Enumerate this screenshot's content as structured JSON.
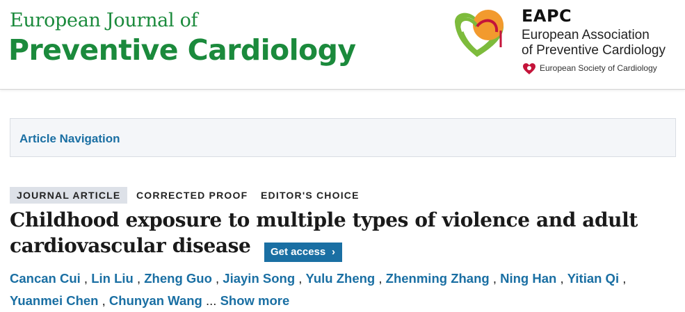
{
  "header": {
    "journal_line1": "European Journal of",
    "journal_line2": "Preventive Cardiology",
    "eapc_abbrev": "EAPC",
    "eapc_line1": "European Association",
    "eapc_line2": "of Preventive Cardiology",
    "esc_name": "European Society of Cardiology"
  },
  "nav": {
    "article_navigation": "Article Navigation"
  },
  "article": {
    "tags": [
      "JOURNAL ARTICLE",
      "CORRECTED PROOF",
      "EDITOR'S CHOICE"
    ],
    "title_line1": "Childhood exposure to multiple types of violence and adult",
    "title_line2": "cardiovascular disease",
    "get_access": "Get access",
    "authors_line1": [
      "Cancan Cui",
      "Lin Liu",
      "Zheng Guo",
      "Jiayin Song",
      "Yulu Zheng",
      "Zhenming Zhang",
      "Ning Han",
      "Yitian Qi"
    ],
    "authors_line2": [
      "Yuanmei Chen",
      "Chunyan Wang"
    ],
    "separator": ",",
    "ellipsis": "...",
    "show_more": "Show more"
  },
  "colors": {
    "journal_green": "#1b8a3c",
    "link_blue": "#1a6fa3",
    "tag_bg": "#dde1e8"
  }
}
